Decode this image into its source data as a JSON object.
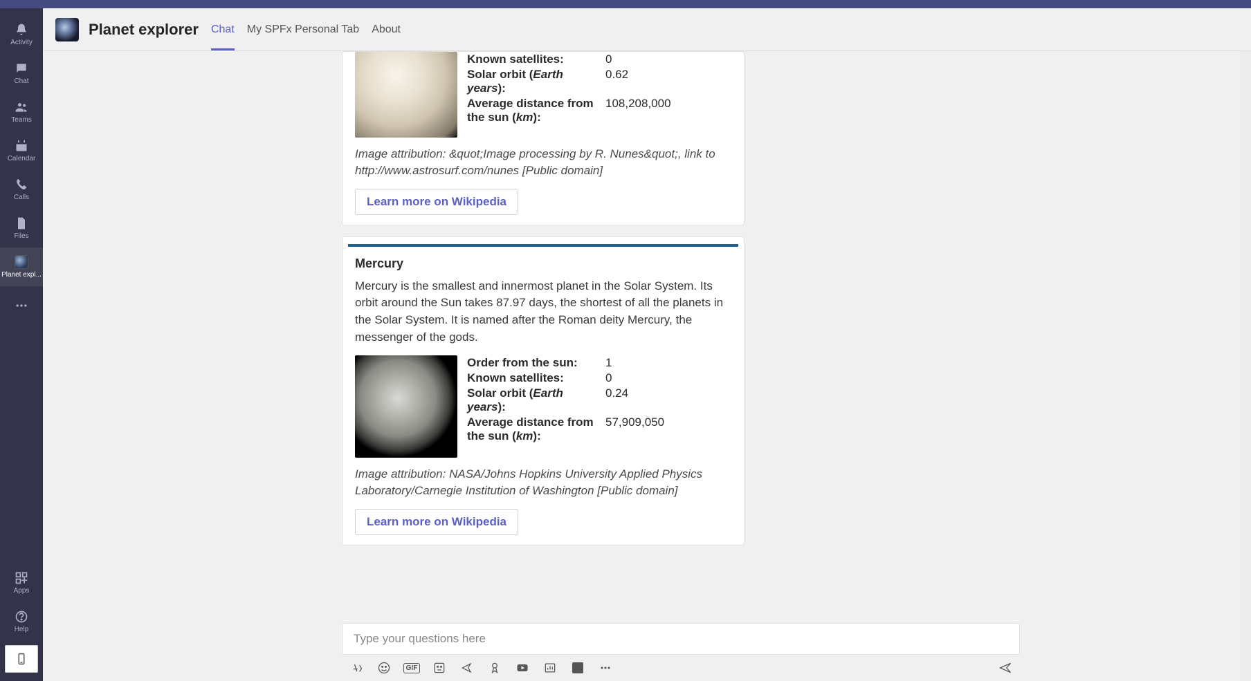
{
  "rail": {
    "items": [
      {
        "label": "Activity"
      },
      {
        "label": "Chat"
      },
      {
        "label": "Teams"
      },
      {
        "label": "Calendar"
      },
      {
        "label": "Calls"
      },
      {
        "label": "Files"
      },
      {
        "label": "Planet expl..."
      }
    ],
    "apps_label": "Apps",
    "help_label": "Help"
  },
  "header": {
    "app_title": "Planet explorer",
    "tabs": [
      {
        "label": "Chat"
      },
      {
        "label": "My SPFx Personal Tab"
      },
      {
        "label": "About"
      }
    ]
  },
  "cards": {
    "venus": {
      "facts": {
        "known_satellites_label": "Known satellites:",
        "known_satellites_value": "0",
        "solar_orbit_label_a": "Solar orbit (",
        "solar_orbit_unit": "Earth years",
        "solar_orbit_label_b": "):",
        "solar_orbit_value": "0.62",
        "avg_dist_label_a": "Average distance from the sun (",
        "avg_dist_unit": "km",
        "avg_dist_label_b": "):",
        "avg_dist_value": "108,208,000"
      },
      "attribution": "Image attribution: &quot;Image processing by R. Nunes&quot;, link to http://www.astrosurf.com/nunes [Public domain]",
      "button_label": "Learn more on Wikipedia"
    },
    "mercury": {
      "title": "Mercury",
      "description": "Mercury is the smallest and innermost planet in the Solar System. Its orbit around the Sun takes 87.97 days, the shortest of all the planets in the Solar System. It is named after the Roman deity Mercury, the messenger of the gods.",
      "facts": {
        "order_label": "Order from the sun:",
        "order_value": "1",
        "known_satellites_label": "Known satellites:",
        "known_satellites_value": "0",
        "solar_orbit_label_a": "Solar orbit (",
        "solar_orbit_unit": "Earth years",
        "solar_orbit_label_b": "):",
        "solar_orbit_value": "0.24",
        "avg_dist_label_a": "Average distance from the sun (",
        "avg_dist_unit": "km",
        "avg_dist_label_b": "):",
        "avg_dist_value": "57,909,050"
      },
      "attribution": "Image attribution: NASA/Johns Hopkins University Applied Physics Laboratory/Carnegie Institution of Washington [Public domain]",
      "button_label": "Learn more on Wikipedia"
    }
  },
  "compose": {
    "placeholder": "Type your questions here"
  }
}
